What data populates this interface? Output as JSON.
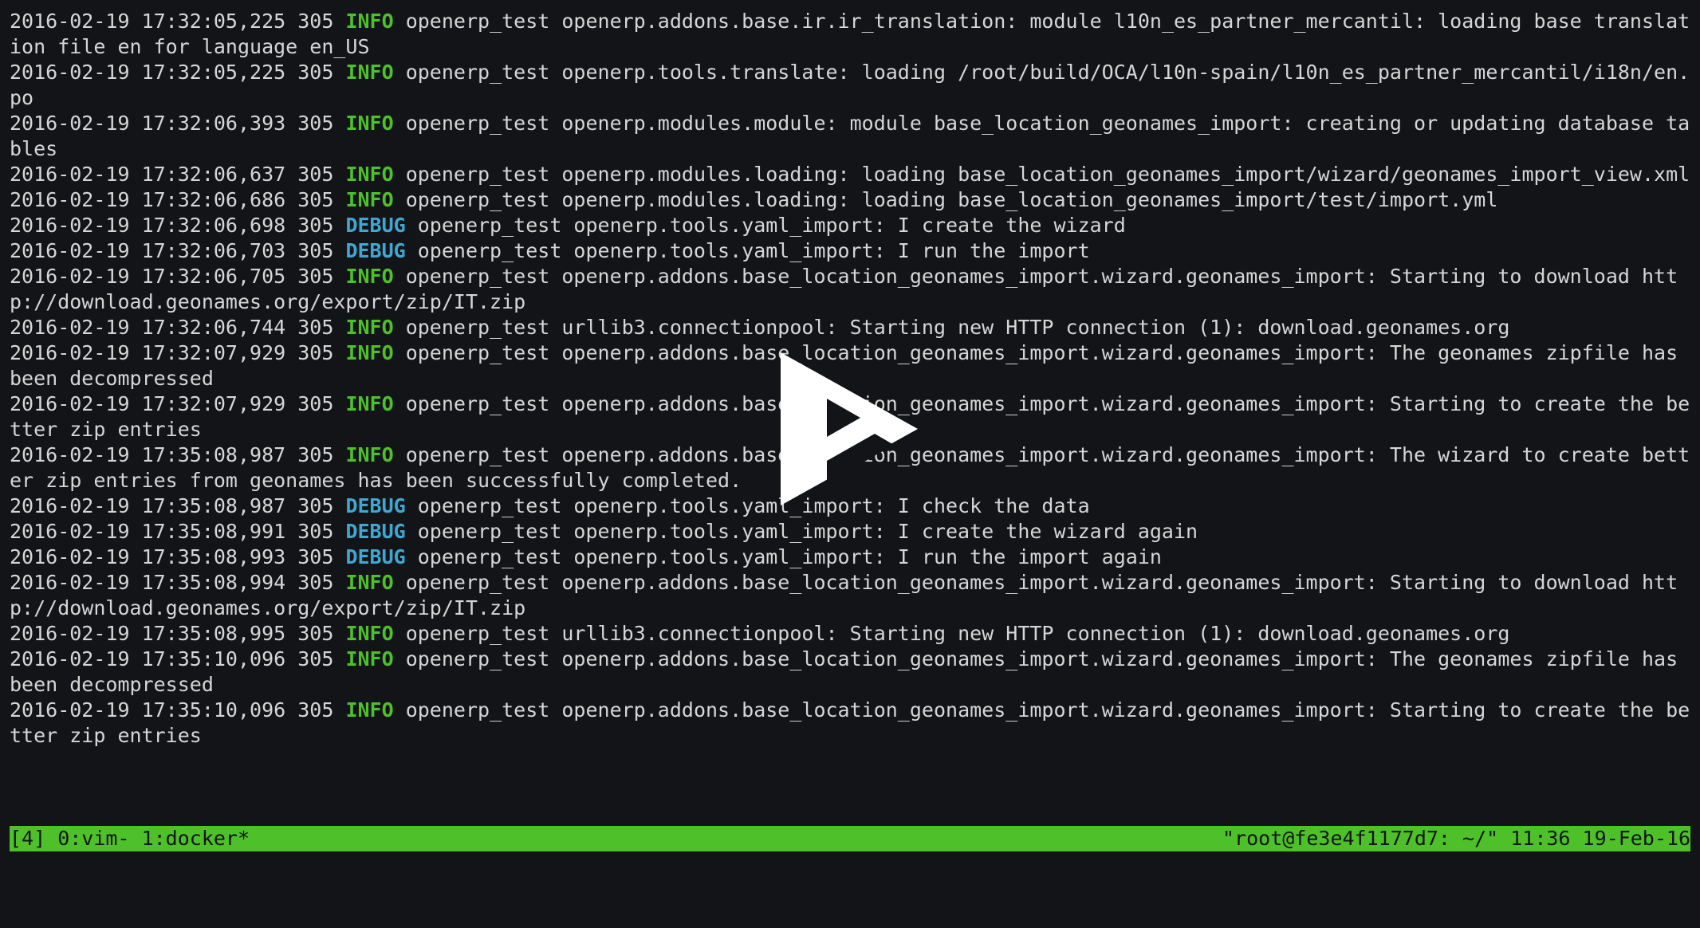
{
  "terminal": {
    "lines": [
      {
        "ts": "2016-02-19 17:32:05,225 305 ",
        "level": "INFO",
        "msg": " openerp_test openerp.addons.base.ir.ir_translation: module l10n_es_partner_mercantil: loading base translation file en for language en_US"
      },
      {
        "ts": "2016-02-19 17:32:05,225 305 ",
        "level": "INFO",
        "msg": " openerp_test openerp.tools.translate: loading /root/build/OCA/l10n-spain/l10n_es_partner_mercantil/i18n/en.po"
      },
      {
        "ts": "2016-02-19 17:32:06,393 305 ",
        "level": "INFO",
        "msg": " openerp_test openerp.modules.module: module base_location_geonames_import: creating or updating database tables"
      },
      {
        "ts": "2016-02-19 17:32:06,637 305 ",
        "level": "INFO",
        "msg": " openerp_test openerp.modules.loading: loading base_location_geonames_import/wizard/geonames_import_view.xml"
      },
      {
        "ts": "2016-02-19 17:32:06,686 305 ",
        "level": "INFO",
        "msg": " openerp_test openerp.modules.loading: loading base_location_geonames_import/test/import.yml"
      },
      {
        "ts": "2016-02-19 17:32:06,698 305 ",
        "level": "DEBUG",
        "msg": " openerp_test openerp.tools.yaml_import: I create the wizard"
      },
      {
        "ts": "2016-02-19 17:32:06,703 305 ",
        "level": "DEBUG",
        "msg": " openerp_test openerp.tools.yaml_import: I run the import"
      },
      {
        "ts": "2016-02-19 17:32:06,705 305 ",
        "level": "INFO",
        "msg": " openerp_test openerp.addons.base_location_geonames_import.wizard.geonames_import: Starting to download http://download.geonames.org/export/zip/IT.zip"
      },
      {
        "ts": "2016-02-19 17:32:06,744 305 ",
        "level": "INFO",
        "msg": " openerp_test urllib3.connectionpool: Starting new HTTP connection (1): download.geonames.org"
      },
      {
        "ts": "2016-02-19 17:32:07,929 305 ",
        "level": "INFO",
        "msg": " openerp_test openerp.addons.base_location_geonames_import.wizard.geonames_import: The geonames zipfile has been decompressed"
      },
      {
        "ts": "2016-02-19 17:32:07,929 305 ",
        "level": "INFO",
        "msg": " openerp_test openerp.addons.base_location_geonames_import.wizard.geonames_import: Starting to create the better zip entries"
      },
      {
        "ts": "2016-02-19 17:35:08,987 305 ",
        "level": "INFO",
        "msg": " openerp_test openerp.addons.base_location_geonames_import.wizard.geonames_import: The wizard to create better zip entries from geonames has been successfully completed."
      },
      {
        "ts": "2016-02-19 17:35:08,987 305 ",
        "level": "DEBUG",
        "msg": " openerp_test openerp.tools.yaml_import: I check the data"
      },
      {
        "ts": "2016-02-19 17:35:08,991 305 ",
        "level": "DEBUG",
        "msg": " openerp_test openerp.tools.yaml_import: I create the wizard again"
      },
      {
        "ts": "2016-02-19 17:35:08,993 305 ",
        "level": "DEBUG",
        "msg": " openerp_test openerp.tools.yaml_import: I run the import again"
      },
      {
        "ts": "2016-02-19 17:35:08,994 305 ",
        "level": "INFO",
        "msg": " openerp_test openerp.addons.base_location_geonames_import.wizard.geonames_import: Starting to download http://download.geonames.org/export/zip/IT.zip"
      },
      {
        "ts": "2016-02-19 17:35:08,995 305 ",
        "level": "INFO",
        "msg": " openerp_test urllib3.connectionpool: Starting new HTTP connection (1): download.geonames.org"
      },
      {
        "ts": "2016-02-19 17:35:10,096 305 ",
        "level": "INFO",
        "msg": " openerp_test openerp.addons.base_location_geonames_import.wizard.geonames_import: The geonames zipfile has been decompressed"
      },
      {
        "ts": "2016-02-19 17:35:10,096 305 ",
        "level": "INFO",
        "msg": " openerp_test openerp.addons.base_location_geonames_import.wizard.geonames_import: Starting to create the better zip entries"
      }
    ]
  },
  "status_bar": {
    "left": "[4] 0:vim- 1:docker*",
    "right": "\"root@fe3e4f1177d7: ~/\" 11:36 19-Feb-16"
  },
  "player": {
    "icon": "play-icon"
  },
  "colors": {
    "background": "#121418",
    "text": "#d6d6d6",
    "info": "#4ec02a",
    "debug": "#3ea8d2",
    "status_bar": "#4ec02a"
  }
}
